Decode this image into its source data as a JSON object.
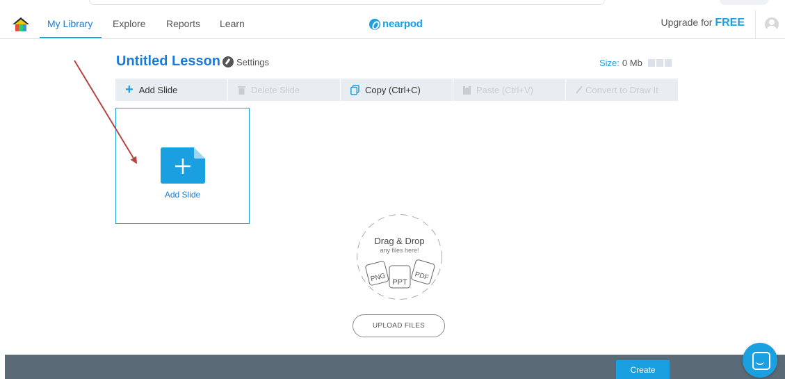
{
  "nav": {
    "home_icon": "house-icon",
    "items": [
      {
        "label": "My Library",
        "active": true
      },
      {
        "label": "Explore",
        "active": false
      },
      {
        "label": "Reports",
        "active": false
      },
      {
        "label": "Learn",
        "active": false
      }
    ],
    "logo_text": "nearpod",
    "upgrade_prefix": "Upgrade for",
    "upgrade_emphasis": "FREE",
    "avatar_icon": "user-avatar-icon"
  },
  "lesson": {
    "title": "Untitled Lesson",
    "settings_label": "Settings",
    "size_label": "Size:",
    "size_value": "0 Mb"
  },
  "toolbar": {
    "add_slide": "Add Slide",
    "delete_slide": "Delete Slide",
    "copy": "Copy (Ctrl+C)",
    "paste": "Paste (Ctrl+V)",
    "convert": "Convert to Draw It"
  },
  "slide_card": {
    "label": "Add Slide",
    "icon": "add-file-icon"
  },
  "dropzone": {
    "title": "Drag & Drop",
    "subtitle": "any files here!",
    "file_types": [
      "PNG",
      "PPT",
      "PDF"
    ],
    "upload_label": "UPLOAD FILES"
  },
  "footer": {
    "create_label": "Create",
    "chat_icon": "chat-icon"
  },
  "colors": {
    "accent": "#1a9fe0",
    "title_blue": "#1c7bd3",
    "footer": "#5a6a76",
    "toolbar_bg": "#e8edf1",
    "arrow": "#b5443f"
  }
}
